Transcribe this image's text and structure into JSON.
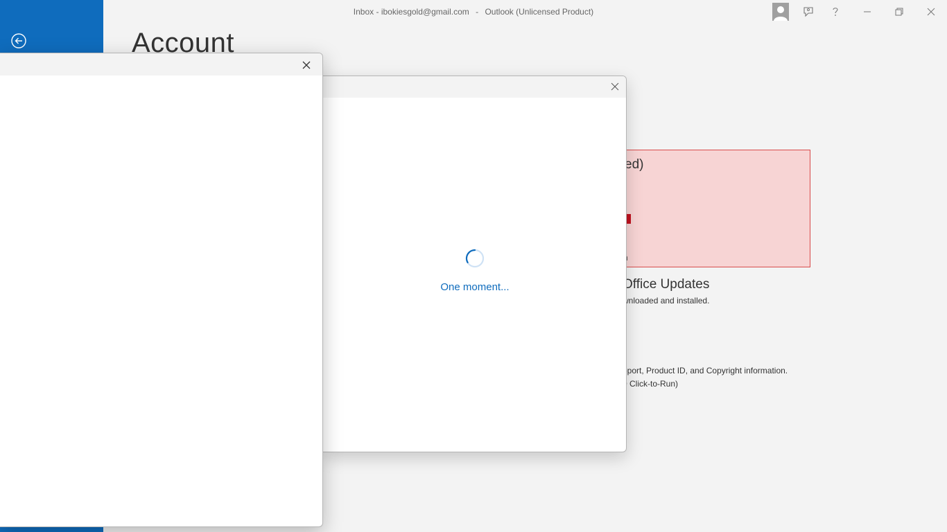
{
  "window": {
    "title": {
      "folder": "Inbox",
      "account": "ibokiesgold@gmail.com",
      "separator": "-",
      "app": "Outlook (Unlicensed Product)"
    }
  },
  "backstage": {
    "page_title": "Account",
    "product_card_title_partial": "ed)",
    "product_card_small_partial": "n",
    "updates_title_partial": "Office Updates",
    "updates_desc_partial": "wnloaded and installed.",
    "about_line_partial": "pport, Product ID, and Copyright information.",
    "about_version_partial": "0 Click-to-Run)"
  },
  "dialog_loading": {
    "status_text": "One moment..."
  },
  "colors": {
    "accent": "#0f6cbd",
    "unlicensed_bg": "#f7d4d4",
    "unlicensed_border": "#d84a4a"
  },
  "icons": {
    "back": "back-arrow-circle-icon",
    "account": "user-avatar-icon",
    "feedback": "feedback-icon",
    "help": "help-icon",
    "minimize": "minimize-icon",
    "restore": "restore-icon",
    "close": "close-icon"
  }
}
